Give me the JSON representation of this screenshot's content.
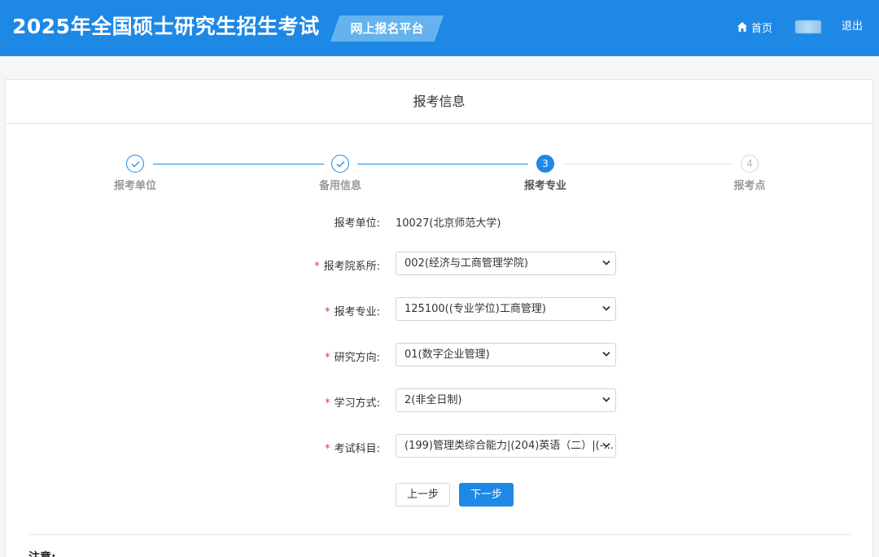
{
  "header": {
    "site_title": "2025年全国硕士研究生招生考试",
    "platform_label": "网上报名平台",
    "home_label": "首页",
    "logout_label": "退出"
  },
  "card": {
    "title": "报考信息"
  },
  "steps": [
    {
      "number": "✓",
      "label": "报考单位",
      "state": "done"
    },
    {
      "number": "✓",
      "label": "备用信息",
      "state": "done"
    },
    {
      "number": "3",
      "label": "报考专业",
      "state": "active"
    },
    {
      "number": "4",
      "label": "报考点",
      "state": "pending"
    }
  ],
  "form": {
    "unit": {
      "label": "报考单位:",
      "value": "10027(北京师范大学)"
    },
    "department": {
      "required": "*",
      "label": "报考院系所:",
      "value": "002(经济与工商管理学院)"
    },
    "major": {
      "required": "*",
      "label": "报考专业:",
      "value": "125100((专业学位)工商管理)"
    },
    "direction": {
      "required": "*",
      "label": "研究方向:",
      "value": "01(数字企业管理)"
    },
    "study_mode": {
      "required": "*",
      "label": "学习方式:",
      "value": "2(非全日制)"
    },
    "subjects": {
      "required": "*",
      "label": "考试科目:",
      "value": "(199)管理类综合能力|(204)英语（二）|(-..."
    }
  },
  "buttons": {
    "prev_label": "上一步",
    "next_label": "下一步"
  },
  "notice": {
    "title": "注意:"
  },
  "colors": {
    "brand": "#1e88e5",
    "required": "#e53935"
  }
}
